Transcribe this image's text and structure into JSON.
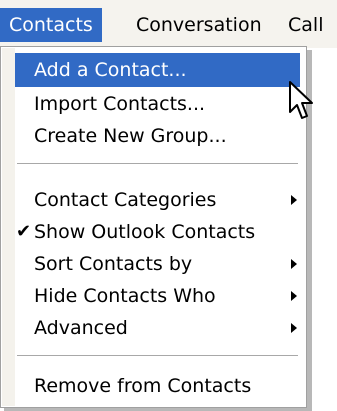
{
  "menubar": {
    "items": [
      {
        "label": "Contacts",
        "active": true
      },
      {
        "label": "Conversation",
        "active": false
      },
      {
        "label": "Call",
        "active": false
      }
    ]
  },
  "dropdown": {
    "groups": [
      [
        {
          "label": "Add a Contact...",
          "highlighted": true
        },
        {
          "label": "Import Contacts..."
        },
        {
          "label": "Create New Group..."
        }
      ],
      [
        {
          "label": "Contact Categories",
          "submenu": true
        },
        {
          "label": "Show Outlook Contacts",
          "checked": true,
          "check_icon": "checkmark-icon"
        },
        {
          "label": "Sort Contacts by",
          "submenu": true
        },
        {
          "label": "Hide Contacts Who",
          "submenu": true
        },
        {
          "label": "Advanced",
          "submenu": true
        }
      ],
      [
        {
          "label": "Remove from Contacts"
        }
      ]
    ],
    "check_glyph": "✔"
  },
  "colors": {
    "highlight": "#316ac5",
    "menubar_bg": "#f5f3ee",
    "border": "#a0a0a0"
  },
  "cursor_icon": "arrow-pointer-icon"
}
